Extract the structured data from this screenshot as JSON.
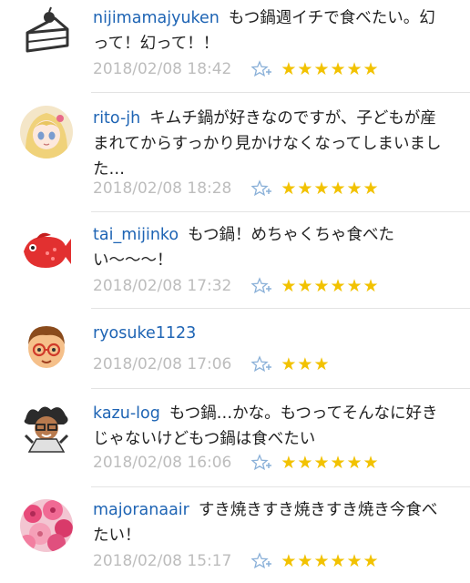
{
  "colors": {
    "username": "#1e64b4",
    "date": "#bdbdbd",
    "star": "#f2c200",
    "divider": "#e3e3e3"
  },
  "comments": [
    {
      "user": "nijimamajyuken",
      "text": "もつ鍋週イチで食べたい。幻って！幻って！！",
      "date": "2018/02/08 18:42",
      "stars": "★★★★★★",
      "avatar": "cake-icon"
    },
    {
      "user": "rito-jh",
      "text": "キムチ鍋が好きなのですが、子どもが産まれてからすっかり見かけなくなってしまいました…",
      "date": "2018/02/08 18:28",
      "stars": "★★★★★★",
      "avatar": "anime-girl-avatar"
    },
    {
      "user": "tai_mijinko",
      "text": "もつ鍋！めちゃくちゃ食べたい〜〜〜！",
      "date": "2018/02/08 17:32",
      "stars": "★★★★★★",
      "avatar": "red-fish-avatar"
    },
    {
      "user": "ryosuke1123",
      "text": "",
      "date": "2018/02/08 17:06",
      "stars": "★★★",
      "avatar": "cartoon-boy-avatar"
    },
    {
      "user": "kazu-log",
      "text": "もつ鍋…かな。もつってそんなに好きじゃないけどもつ鍋は食べたい",
      "date": "2018/02/08 16:06",
      "stars": "★★★★★★",
      "avatar": "cartoon-man-avatar"
    },
    {
      "user": "majoranaair",
      "text": "すき焼きすき焼きすき焼き今食べたい！",
      "date": "2018/02/08 15:17",
      "stars": "★★★★★★",
      "avatar": "flower-bouquet-avatar"
    }
  ]
}
